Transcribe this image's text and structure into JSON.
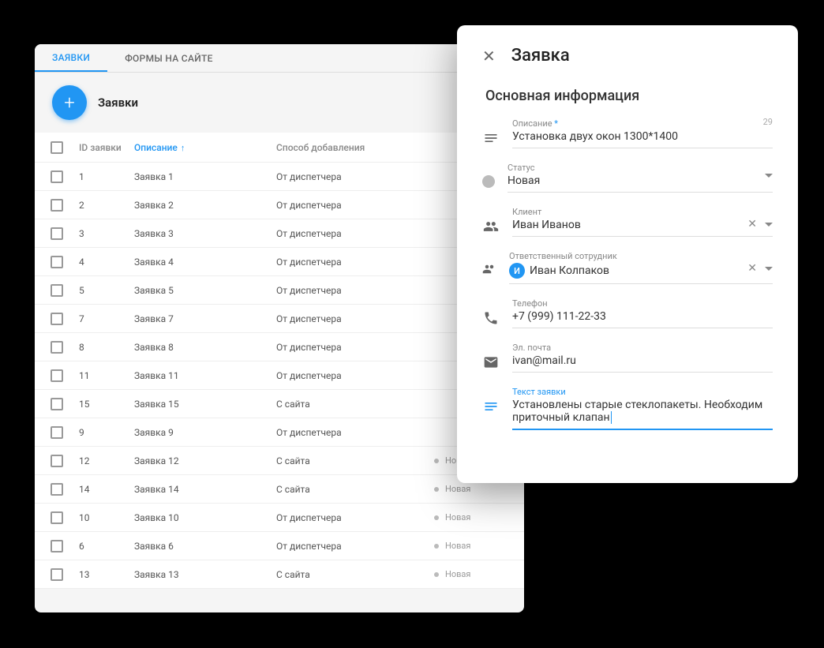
{
  "tabs": [
    {
      "label": "ЗАЯВКИ",
      "active": true
    },
    {
      "label": "ФОРМЫ НА САЙТЕ",
      "active": false
    }
  ],
  "pageTitle": "Заявки",
  "columns": {
    "id": "ID заявки",
    "desc": "Описание",
    "method": "Способ добавления",
    "status": ""
  },
  "rows": [
    {
      "id": "1",
      "desc": "Заявка 1",
      "method": "От диспетчера",
      "status": ""
    },
    {
      "id": "2",
      "desc": "Заявка 2",
      "method": "От диспетчера",
      "status": ""
    },
    {
      "id": "3",
      "desc": "Заявка 3",
      "method": "От диспетчера",
      "status": ""
    },
    {
      "id": "4",
      "desc": "Заявка 4",
      "method": "От диспетчера",
      "status": ""
    },
    {
      "id": "5",
      "desc": "Заявка 5",
      "method": "От диспетчера",
      "status": ""
    },
    {
      "id": "7",
      "desc": "Заявка 7",
      "method": "От диспетчера",
      "status": ""
    },
    {
      "id": "8",
      "desc": "Заявка 8",
      "method": "От диспетчера",
      "status": ""
    },
    {
      "id": "11",
      "desc": "Заявка 11",
      "method": "От диспетчера",
      "status": ""
    },
    {
      "id": "15",
      "desc": "Заявка 15",
      "method": "С сайта",
      "status": ""
    },
    {
      "id": "9",
      "desc": "Заявка 9",
      "method": "От диспетчера",
      "status": ""
    },
    {
      "id": "12",
      "desc": "Заявка 12",
      "method": "С сайта",
      "status": "Новая"
    },
    {
      "id": "14",
      "desc": "Заявка 14",
      "method": "С сайта",
      "status": "Новая"
    },
    {
      "id": "10",
      "desc": "Заявка 10",
      "method": "От диспетчера",
      "status": "Новая"
    },
    {
      "id": "6",
      "desc": "Заявка 6",
      "method": "От диспетчера",
      "status": "Новая"
    },
    {
      "id": "13",
      "desc": "Заявка 13",
      "method": "С сайта",
      "status": "Новая"
    }
  ],
  "detail": {
    "title": "Заявка",
    "sectionTitle": "Основная информация",
    "fields": {
      "description": {
        "label": "Описание",
        "value": "Установка двух окон 1300*1400",
        "counter": "29"
      },
      "status": {
        "label": "Статус",
        "value": "Новая"
      },
      "client": {
        "label": "Клиент",
        "value": "Иван Иванов"
      },
      "employee": {
        "label": "Ответственный сотрудник",
        "value": "Иван Колпаков",
        "initial": "И"
      },
      "phone": {
        "label": "Телефон",
        "value": "+7 (999) 111-22-33"
      },
      "email": {
        "label": "Эл. почта",
        "value": "ivan@mail.ru"
      },
      "text": {
        "label": "Текст заявки",
        "value": "Установлены старые стеклопакеты. Необходим приточный клапан"
      }
    }
  }
}
